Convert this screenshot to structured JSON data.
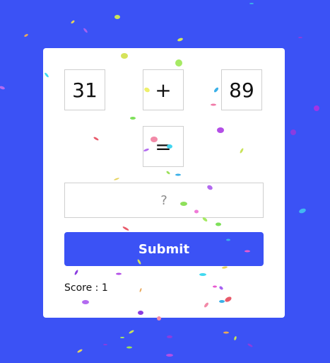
{
  "equation": {
    "operand_a": "31",
    "operator": "+",
    "operand_b": "89",
    "equals": "="
  },
  "answer_input": {
    "value": "",
    "placeholder": "?"
  },
  "submit_label": "Submit",
  "score": {
    "label": "Score : ",
    "value": "1"
  },
  "colors": {
    "background": "#3b52f5",
    "button": "#3b52f5",
    "card": "#ffffff"
  }
}
